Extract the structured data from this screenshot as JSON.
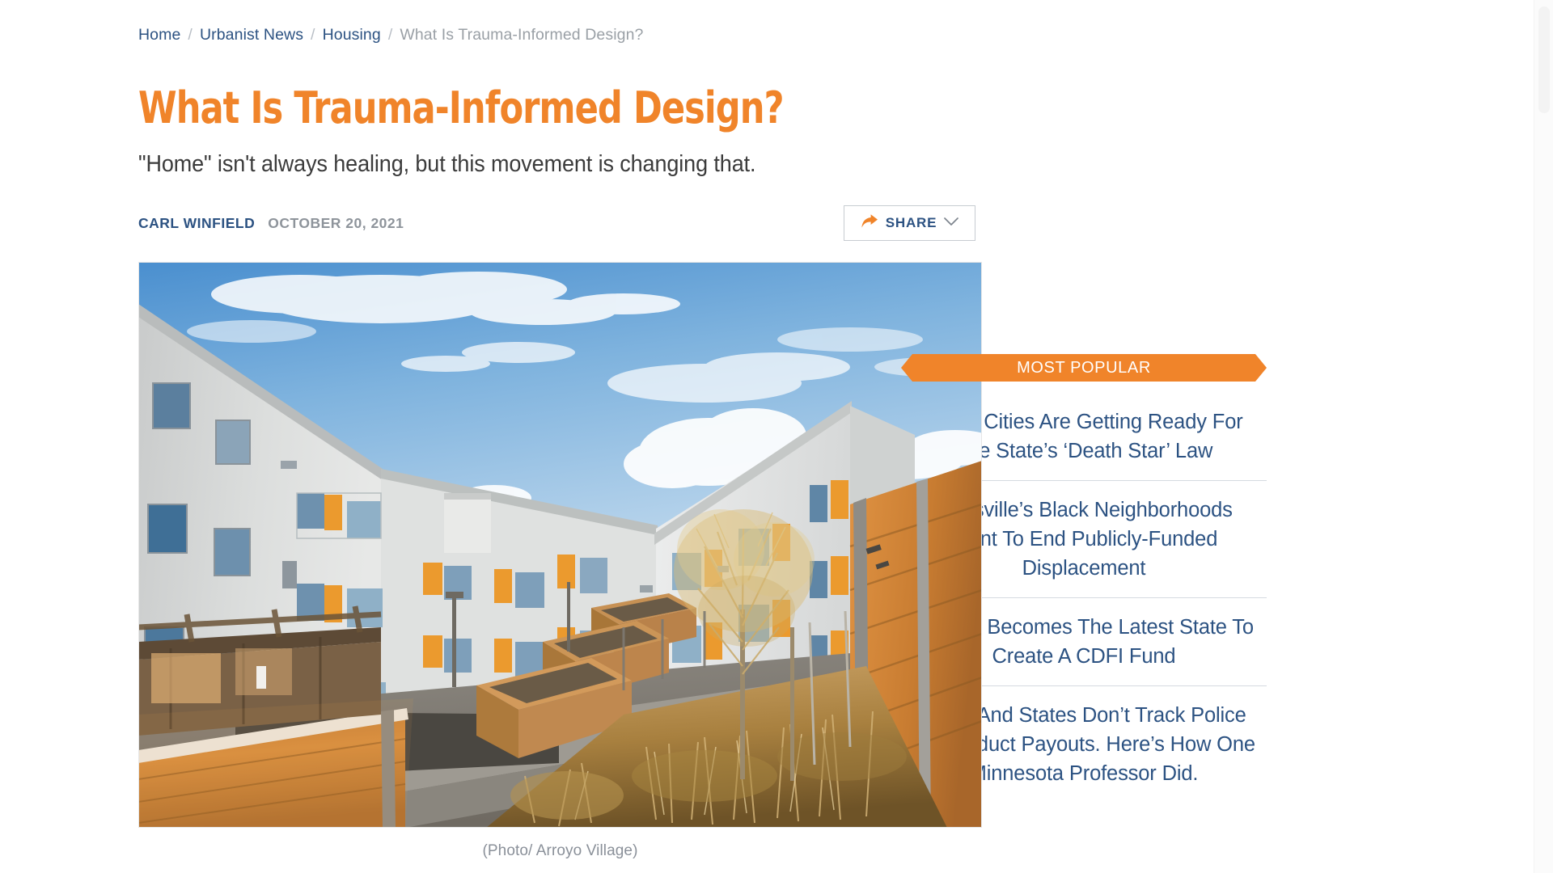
{
  "breadcrumb": {
    "items": [
      {
        "label": "Home",
        "current": false
      },
      {
        "label": "Urbanist News",
        "current": false
      },
      {
        "label": "Housing",
        "current": false
      },
      {
        "label": "What Is Trauma-Informed Design?",
        "current": true
      }
    ],
    "separator": "/"
  },
  "article": {
    "headline": "What Is Trauma-Informed Design?",
    "subhead": "\"Home\" isn't always healing, but this movement is changing that.",
    "author": "CARL WINFIELD",
    "date": "OCTOBER 20, 2021",
    "caption": "(Photo/ Arroyo Village)"
  },
  "share": {
    "label": "SHARE",
    "arrow_icon": "share-arrow-icon",
    "chevron_icon": "chevron-down-icon"
  },
  "sidebar": {
    "ribbon_label": "MOST POPULAR",
    "items": [
      {
        "title": "Texas Cities Are Getting Ready For The State’s ‘Death Star’ Law"
      },
      {
        "title": "Louisville’s Black Neighborhoods Want To End Publicly-Funded Displacement"
      },
      {
        "title": "Virginia Becomes The Latest State To Create A CDFI Fund"
      },
      {
        "title": "Cities And States Don’t Track Police Misconduct Payouts. Here’s How One Minnesota Professor Did."
      }
    ]
  },
  "colors": {
    "accent_orange": "#f0842a",
    "link_navy": "#2c5282",
    "muted_gray": "#9aa0a6",
    "body_text": "#3b3b3b",
    "divider": "#d5dae0",
    "page_background": "#ffffff"
  }
}
